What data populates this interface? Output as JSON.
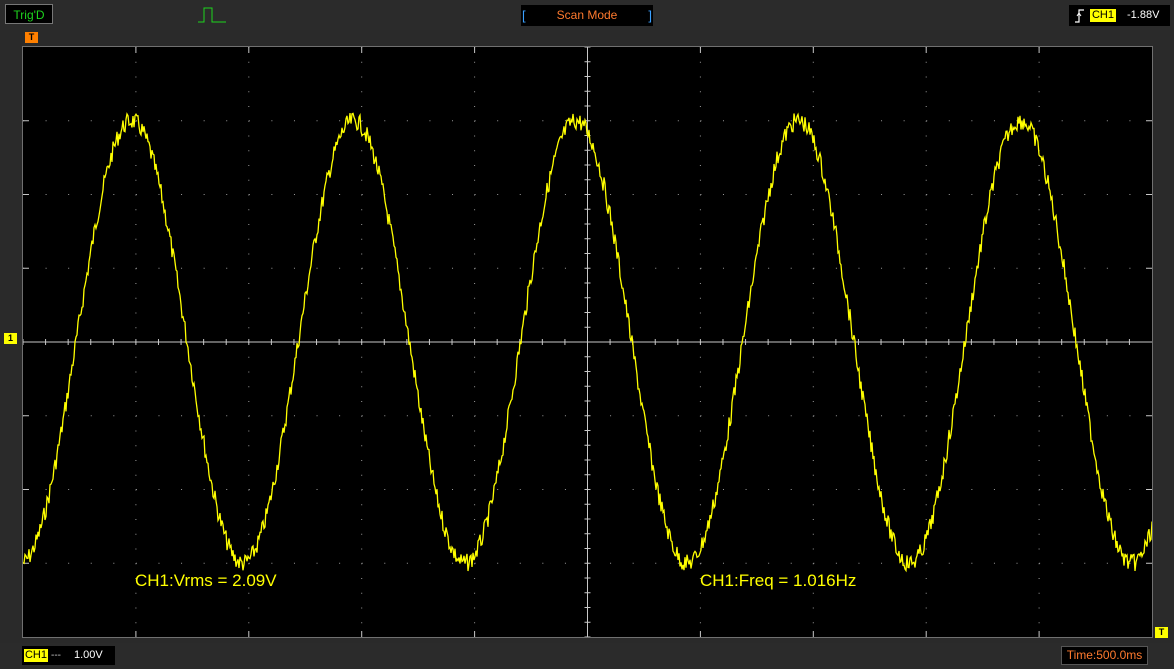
{
  "toolbar": {
    "trigger_status": "Trig'D",
    "mode": "Scan Mode",
    "trigger_channel": "CH1",
    "trigger_level": "-1.88V"
  },
  "markers": {
    "trigger_position": "T",
    "channel_ground": "1",
    "trigger_level": "T"
  },
  "bottom": {
    "channel": "CH1",
    "coupling": "---",
    "volts_per_div": "1.00V",
    "timebase": "Time:500.0ms"
  },
  "measurements": {
    "vrms": "CH1:Vrms = 2.09V",
    "freq": "CH1:Freq = 1.016Hz"
  },
  "waveform": {
    "color": "#ffff00",
    "amplitude_div": 3,
    "cycles_on_screen": 5.08,
    "offset_div": 0
  },
  "colors": {
    "trace": "#ffff00",
    "grid": "#9a9a9a",
    "status": "#1ed41e",
    "accent": "#ff7a2e"
  }
}
